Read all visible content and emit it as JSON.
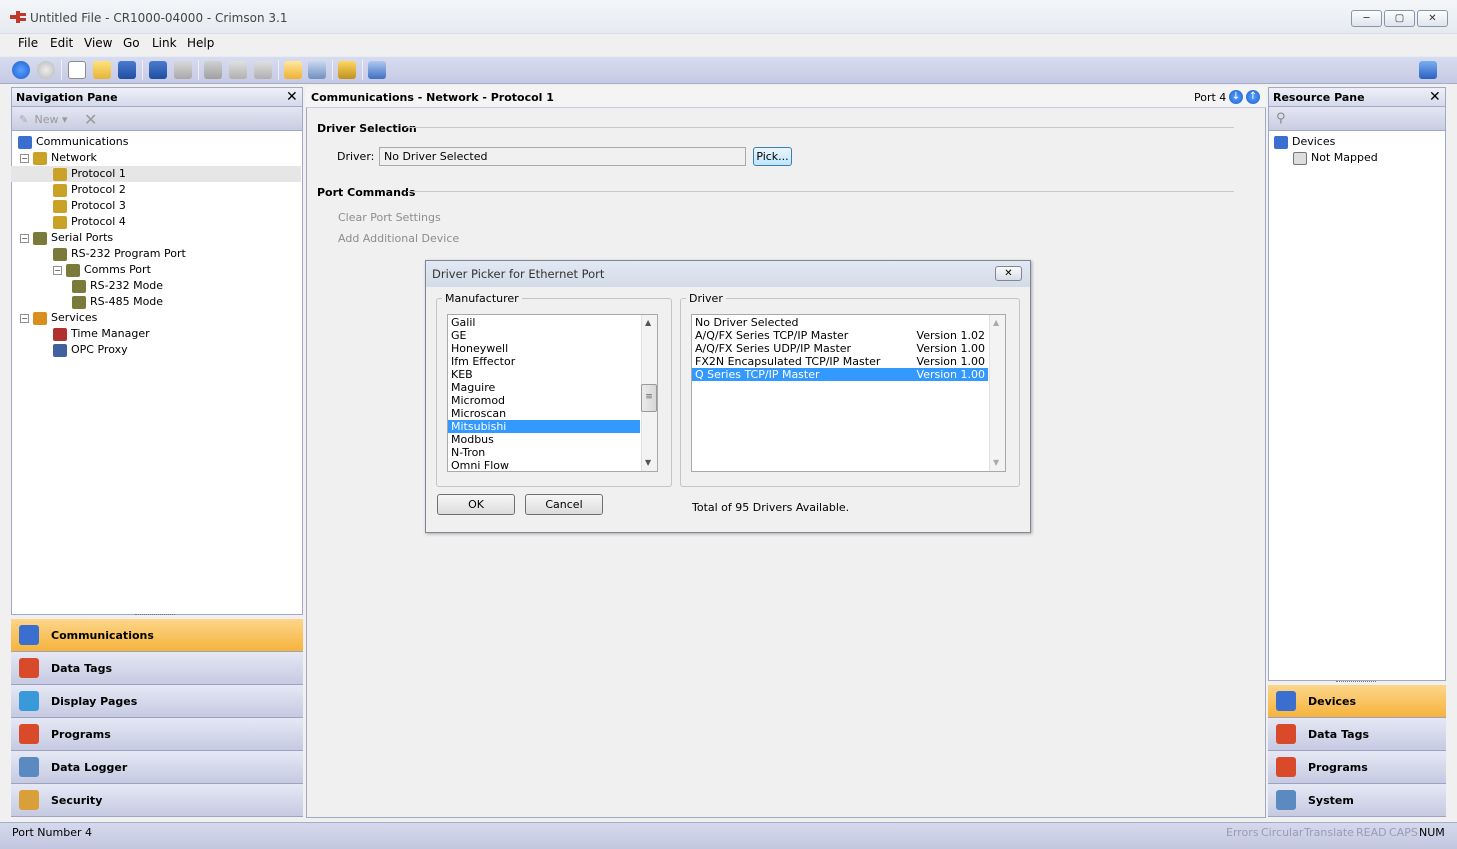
{
  "window": {
    "title": "Untitled File - CR1000-04000 - Crimson 3.1",
    "minimize": "─",
    "maximize": "▢",
    "close": "✕"
  },
  "menu": [
    "File",
    "Edit",
    "View",
    "Go",
    "Link",
    "Help"
  ],
  "nav_pane": {
    "title": "Navigation Pane",
    "new_label": "New",
    "tree": [
      {
        "label": "Communications",
        "level": 0
      },
      {
        "label": "Network",
        "level": 1
      },
      {
        "label": "Protocol 1",
        "level": 2,
        "selected": true
      },
      {
        "label": "Protocol 2",
        "level": 2
      },
      {
        "label": "Protocol 3",
        "level": 2
      },
      {
        "label": "Protocol 4",
        "level": 2
      },
      {
        "label": "Serial Ports",
        "level": 1
      },
      {
        "label": "RS-232 Program Port",
        "level": 2
      },
      {
        "label": "Comms Port",
        "level": 2
      },
      {
        "label": "RS-232 Mode",
        "level": 3
      },
      {
        "label": "RS-485 Mode",
        "level": 3
      },
      {
        "label": "Services",
        "level": 1
      },
      {
        "label": "Time Manager",
        "level": 2
      },
      {
        "label": "OPC Proxy",
        "level": 2
      }
    ],
    "categories": [
      "Communications",
      "Data Tags",
      "Display Pages",
      "Programs",
      "Data Logger",
      "Security"
    ]
  },
  "center": {
    "breadcrumb": "Communications - Network - Protocol 1",
    "port_label": "Port 4",
    "driver_selection_title": "Driver Selection",
    "driver_label": "Driver:",
    "driver_value": "No Driver Selected",
    "pick_button": "Pick...",
    "port_commands_title": "Port Commands",
    "clear_port_settings": "Clear Port Settings",
    "add_additional_device": "Add Additional Device"
  },
  "dialog": {
    "title": "Driver Picker for Ethernet Port",
    "manufacturer_label": "Manufacturer",
    "driver_label": "Driver",
    "manufacturers": [
      "Galil",
      "GE",
      "Honeywell",
      "Ifm Effector",
      "KEB",
      "Maguire",
      "Micromod",
      "Microscan",
      "Mitsubishi",
      "Modbus",
      "N-Tron",
      "Omni Flow"
    ],
    "selected_manufacturer": "Mitsubishi",
    "drivers": [
      {
        "name": "No Driver Selected",
        "version": ""
      },
      {
        "name": "A/Q/FX Series TCP/IP Master",
        "version": "Version 1.02"
      },
      {
        "name": "A/Q/FX Series UDP/IP Master",
        "version": "Version 1.00"
      },
      {
        "name": "FX2N Encapsulated TCP/IP Master",
        "version": "Version 1.00"
      },
      {
        "name": "Q Series TCP/IP Master",
        "version": "Version 1.00",
        "selected": true
      }
    ],
    "ok": "OK",
    "cancel": "Cancel",
    "total_text": "Total of 95 Drivers Available."
  },
  "resource_pane": {
    "title": "Resource Pane",
    "tree": [
      {
        "label": "Devices",
        "level": 0
      },
      {
        "label": "Not Mapped",
        "level": 1
      }
    ],
    "categories": [
      "Devices",
      "Data Tags",
      "Programs",
      "System"
    ]
  },
  "status": {
    "left": "Port Number 4",
    "indicators": [
      "Errors",
      "Circular",
      "Translate",
      "READ",
      "CAPS",
      "NUM"
    ]
  },
  "colors": {
    "accent_selected": "#3399ff",
    "category_active": "#f6b33c",
    "pane_header": "#d6d9ea"
  }
}
